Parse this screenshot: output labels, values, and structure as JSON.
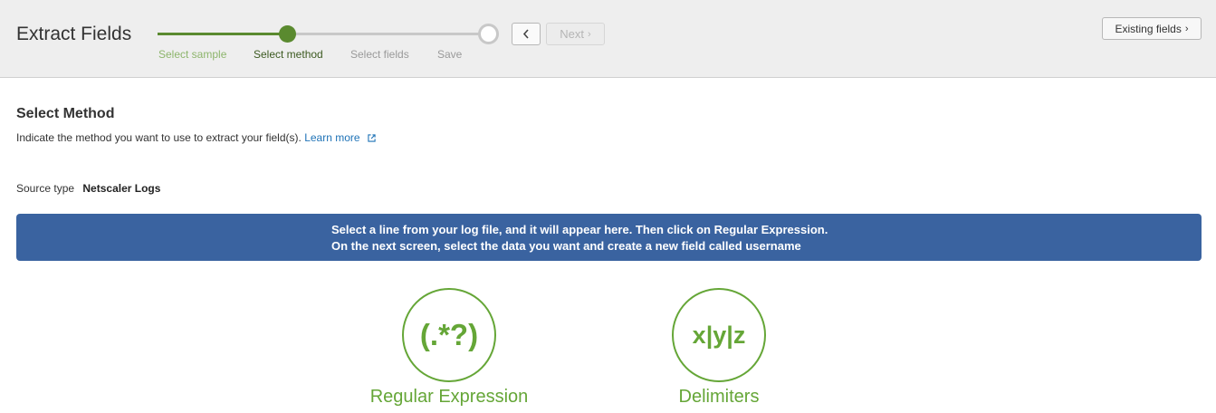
{
  "header": {
    "title": "Extract Fields",
    "steps": [
      "Select sample",
      "Select method",
      "Select fields",
      "Save"
    ],
    "current_step": 2,
    "back_icon": "chevron-left-icon",
    "next_label": "Next",
    "next_icon": "chevron-right-icon",
    "existing_fields_label": "Existing fields",
    "existing_fields_icon": "chevron-right-icon"
  },
  "main": {
    "section_title": "Select Method",
    "instructions": "Indicate the method you want to use to extract your field(s).",
    "learn_more": "Learn more",
    "learn_more_icon": "external-link-icon",
    "source_type_label": "Source type",
    "source_type_value": "Netscaler Logs",
    "banner": {
      "line1": "Select a line from your log file, and it will appear here. Then click on Regular Expression.",
      "line2": "On the next screen, select the data you want and create a new field called username"
    },
    "methods": [
      {
        "symbol": "(.*?)",
        "label": "Regular Expression"
      },
      {
        "symbol": "x|y|z",
        "label": "Delimiters"
      }
    ]
  },
  "colors": {
    "accent_green": "#65a637",
    "stepper_green": "#5a8a2f",
    "banner_blue": "#3a63a0",
    "link_blue": "#1f73b7"
  }
}
